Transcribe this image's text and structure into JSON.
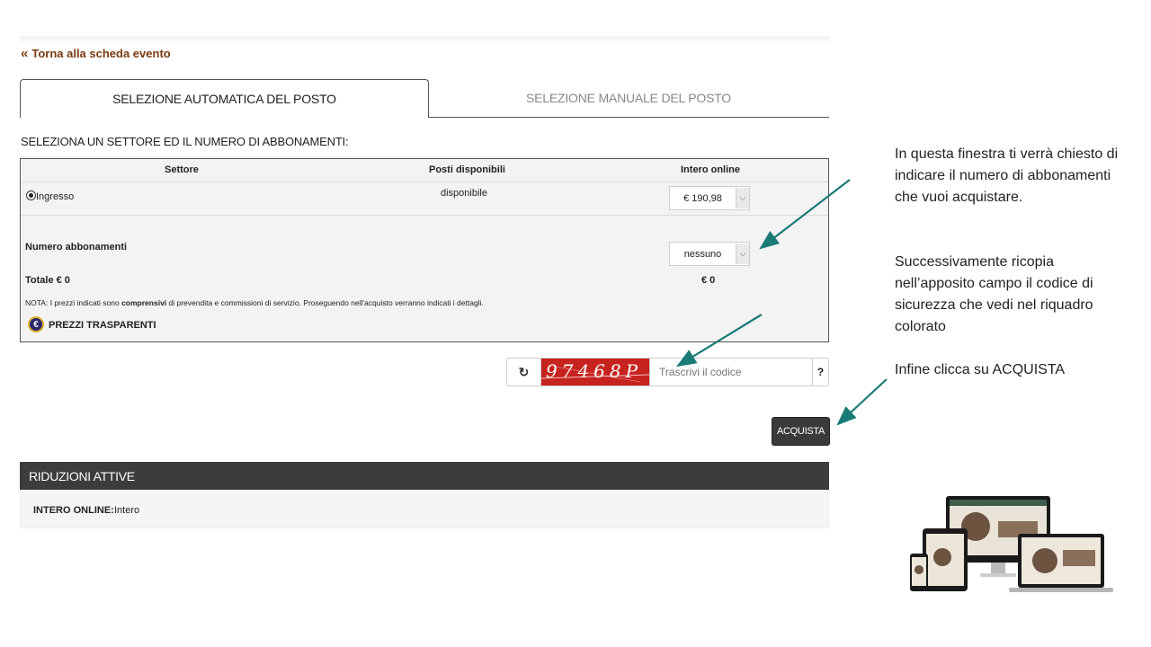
{
  "back_link": {
    "chevron": "«",
    "label": "Torna alla scheda evento"
  },
  "tabs": [
    {
      "label": "SELEZIONE AUTOMATICA DEL POSTO",
      "active": true
    },
    {
      "label": "SELEZIONE MANUALE DEL POSTO",
      "active": false
    }
  ],
  "select_title": "SELEZIONA UN SETTORE ED IL NUMERO DI ABBONAMENTI:",
  "table": {
    "headers": [
      "Settore",
      "Posti disponibili",
      "Intero online"
    ],
    "row": {
      "sector": "Ingresso",
      "availability": "disponibile",
      "price": "€ 190,98"
    },
    "num_label": "Numero abbonamenti",
    "num_value": "nessuno",
    "total_label": "Totale € 0",
    "total_value": "€ 0",
    "note_pre": "NOTA: I prezzi indicati sono ",
    "note_bold": "comprensivi",
    "note_post": " di prevendita e commissioni di servizio. Proseguendo nell'acquisto verranno indicati i dettagli.",
    "transparent_label": "PREZZI TRASPARENTI",
    "euro_symbol": "€"
  },
  "captcha": {
    "refresh_icon": "refresh-icon",
    "code_text": "97468P",
    "input_placeholder": "Trascrivi il codice",
    "help_label": "?"
  },
  "buy_label": "ACQUISTA",
  "reductions": {
    "title": "RIDUZIONI ATTIVE",
    "label": "INTERO ONLINE:",
    "value": "Intero"
  },
  "instructions": [
    "In questa finestra ti verrà chiesto di indicare il numero di abbonamenti che vuoi acquistare.",
    "Successivamente ricopia nell’apposito campo il codice di sicurezza che vedi nel riquadro colorato",
    "Infine clicca su ACQUISTA"
  ],
  "colors": {
    "back_link": "#7a3a10",
    "captcha_bg": "#c6231f",
    "arrow": "#1a7a76",
    "dark_header": "#3c3c3c"
  }
}
